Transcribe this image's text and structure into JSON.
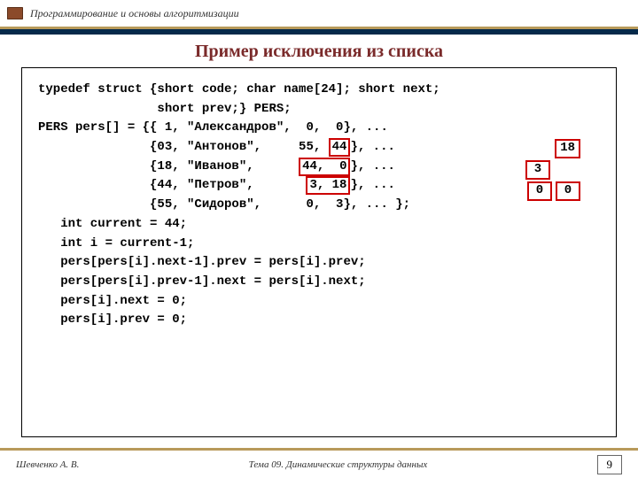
{
  "header": {
    "course": "Программирование и основы алгоритмизации"
  },
  "title": "Пример исключения из списка",
  "code": {
    "l1": "typedef struct {short code; char name[24]; short next;",
    "l2": "                short prev;} PERS;",
    "l3": "",
    "l4a": "PERS pers[] = {{ 1, \"Александров\",  0,  0}, ...",
    "l5a": "               {03, \"Антонов\",     55, ",
    "l5b": "44",
    "l5c": "}, ...",
    "l6a": "               {18, \"Иванов\",      ",
    "l6b": "44,  0",
    "l6c": "}, ...",
    "l7a": "               {44, \"Петров\",       ",
    "l7b": "3, 18",
    "l7c": "}, ...",
    "l8a": "               {55, \"Сидоров\",      0,  3}, ... };",
    "l9": "",
    "l10": "   int current = 44;",
    "l11": "   int i = current-1;",
    "l12": "   pers[pers[i].next-1].prev = pers[i].prev;",
    "l13": "   pers[pers[i].prev-1].next = pers[i].next;",
    "l14": "   pers[i].next = 0;",
    "l15": "   pers[i].prev = 0;"
  },
  "annotations": {
    "top": "18",
    "mid": "3",
    "bot_a": "0",
    "bot_b": "0"
  },
  "footer": {
    "author": "Шевченко А. В.",
    "topic": "Тема 09. Динамические структуры данных",
    "page": "9"
  }
}
